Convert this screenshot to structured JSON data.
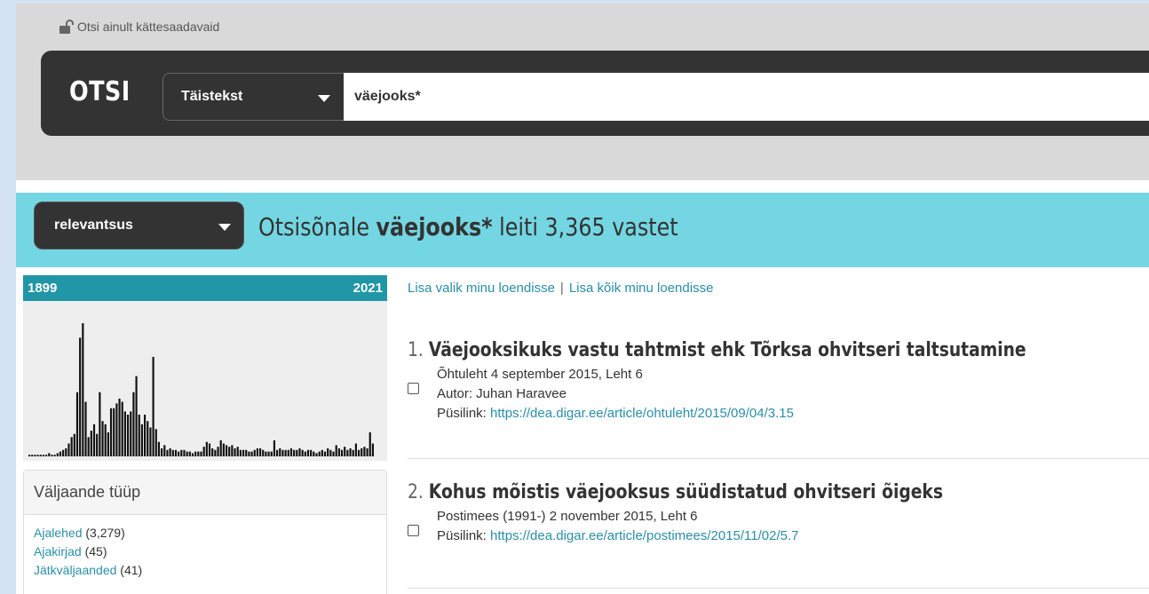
{
  "search": {
    "lock_label": "Otsi ainult kättesaadavaid",
    "button_label": "OTSI",
    "type_selected": "Täistekst",
    "query": "väejooks*"
  },
  "results_header": {
    "sort_selected": "relevantsus",
    "prefix": "Otsisõnale ",
    "term": "väejooks*",
    "suffix": " leiti 3,365 vastet"
  },
  "timeline": {
    "start_year": "1899",
    "end_year": "2021",
    "bar_color": "#111111",
    "values": [
      1,
      1,
      1,
      1,
      1,
      1,
      1,
      2,
      1,
      1,
      2,
      3,
      4,
      5,
      8,
      12,
      14,
      40,
      74,
      83,
      34,
      12,
      16,
      20,
      14,
      40,
      22,
      20,
      15,
      30,
      30,
      33,
      36,
      34,
      28,
      26,
      28,
      40,
      50,
      26,
      20,
      26,
      22,
      18,
      62,
      17,
      9,
      5,
      7,
      4,
      5,
      4,
      4,
      3,
      4,
      4,
      3,
      3,
      2,
      3,
      3,
      3,
      6,
      9,
      8,
      5,
      4,
      6,
      10,
      8,
      7,
      6,
      7,
      5,
      6,
      4,
      4,
      4,
      3,
      3,
      4,
      5,
      5,
      4,
      3,
      3,
      3,
      10,
      4,
      5,
      4,
      4,
      4,
      5,
      4,
      4,
      5,
      4,
      3,
      4,
      4,
      3,
      2,
      3,
      4,
      3,
      5,
      4,
      3,
      7,
      5,
      4,
      6,
      4,
      5,
      4,
      8,
      4,
      5,
      6,
      5,
      15,
      8
    ]
  },
  "facet": {
    "title": "Väljaande tüüp",
    "items": [
      {
        "label": "Ajalehed",
        "count": "(3,279)"
      },
      {
        "label": "Ajakirjad",
        "count": "(45)"
      },
      {
        "label": "Jätkväljaanded",
        "count": "(41)"
      }
    ]
  },
  "list_actions": {
    "add_selected": "Lisa valik minu loendisse",
    "separator": "|",
    "add_all": "Lisa kõik minu loendisse"
  },
  "results": [
    {
      "num": "1.",
      "title": "Väejooksikuks vastu tahtmist ehk Tõrksa ohvitseri taltsutamine",
      "source": "Õhtuleht 4 september 2015, Leht 6",
      "author": "Autor: Juhan Haravee",
      "permalink_label": "Püsilink: ",
      "permalink": "https://dea.digar.ee/article/ohtuleht/2015/09/04/3.15"
    },
    {
      "num": "2.",
      "title": "Kohus mõistis väejooksus süüdistatud ohvitseri õigeks",
      "source": "Postimees (1991-) 2 november 2015, Leht 6",
      "permalink_label": "Püsilink: ",
      "permalink": "https://dea.digar.ee/article/postimees/2015/11/02/5.7"
    }
  ],
  "colors": {
    "accent_band": "#74d6e3",
    "timeline_header": "#2196a6",
    "link": "#2a8fa8",
    "search_bar": "#333333"
  }
}
